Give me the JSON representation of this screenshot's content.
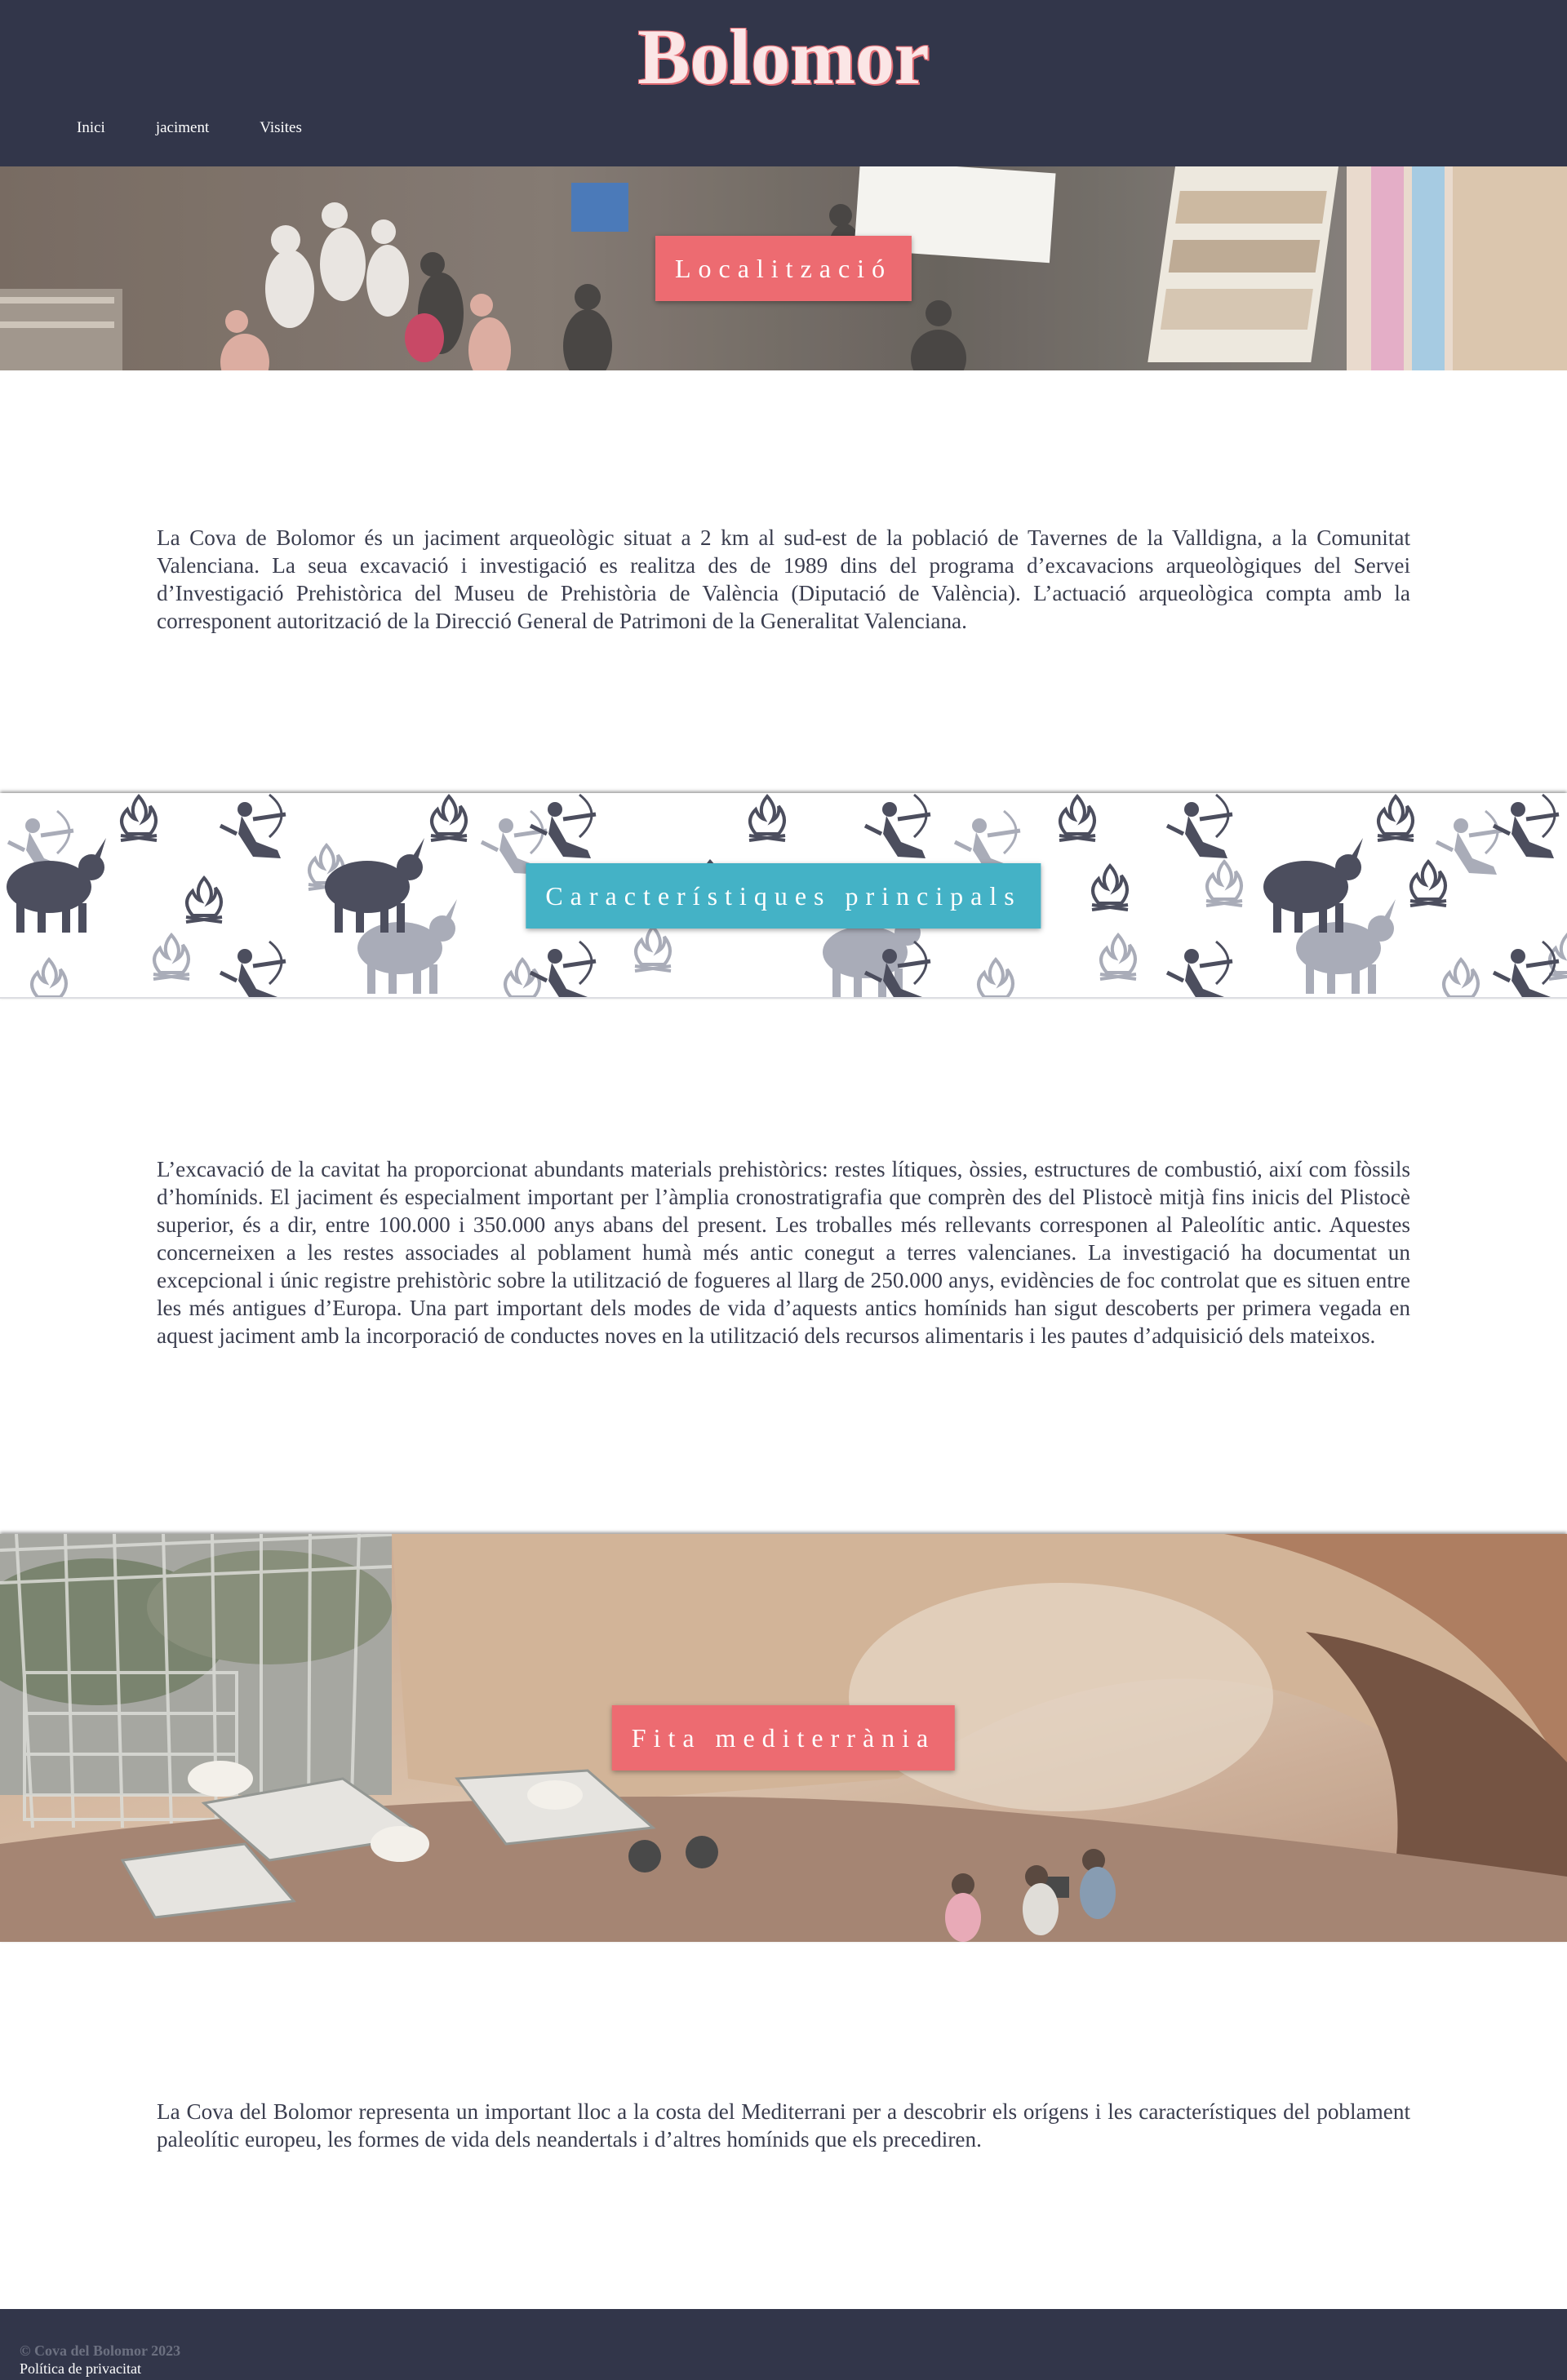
{
  "site": {
    "title": "Bolomor"
  },
  "nav": {
    "items": [
      "Inici",
      "jaciment",
      "Visites"
    ]
  },
  "sections": [
    {
      "heading": "Localització",
      "label_color": "#ed6b71",
      "body": "La Cova de Bolomor és un jaciment arqueològic situat a 2 km al sud-est de la població de Tavernes de la Valldigna, a la Comunitat Valenciana. La seua excavació i investigació es realitza des de 1989 dins del programa d’excavacions arqueològiques del Servei d’Investigació Prehistòrica del Museu de Prehistòria de València (Diputació de València). L’actuació arqueològica compta amb la corresponent autorització de la Direcció General de Patrimoni de la Generalitat Valenciana."
    },
    {
      "heading": "Característiques principals",
      "label_color": "#44b2c6",
      "body": "L’excavació de la cavitat ha proporcionat abundants materials prehistòrics: restes lítiques, òssies, estructures de combustió, així com fòssils d’homínids. El jaciment és especialment important per l’àmplia cronostratigrafia que comprèn des del Plistocè mitjà fins inicis del Plistocè superior, és a dir, entre 100.000 i 350.000 anys abans del present. Les troballes més rellevants corresponen al Paleolític antic. Aquestes concerneixen a les restes associades al poblament humà més antic conegut a terres valencianes. La investigació ha documentat un excepcional i únic registre prehistòric sobre la utilització de fogueres al llarg de 250.000 anys, evidències de foc controlat que es situen entre les més antigues d’Europa. Una part important dels modes de vida d’aquests antics homínids han sigut descoberts per primera vegada en aquest jaciment amb la incorporació de conductes noves en la utilització dels recursos alimentaris i les pautes d’adquisició dels mateixos."
    },
    {
      "heading": "Fita mediterrània",
      "label_color": "#ed6b71",
      "body": "La Cova del Bolomor representa un important lloc a la costa del Mediterrani per a descobrir els orígens i les característiques del poblament paleolític europeu, les formes de vida dels neandertals i d’altres homínids que els precediren."
    }
  ],
  "footer": {
    "copyright": "© Cova del Bolomor 2023",
    "privacy": "Política de privacitat"
  },
  "colors": {
    "header_bg": "#32364a",
    "accent_red": "#ed6b71",
    "accent_teal": "#44b2c6",
    "text": "#3a3d4e"
  }
}
